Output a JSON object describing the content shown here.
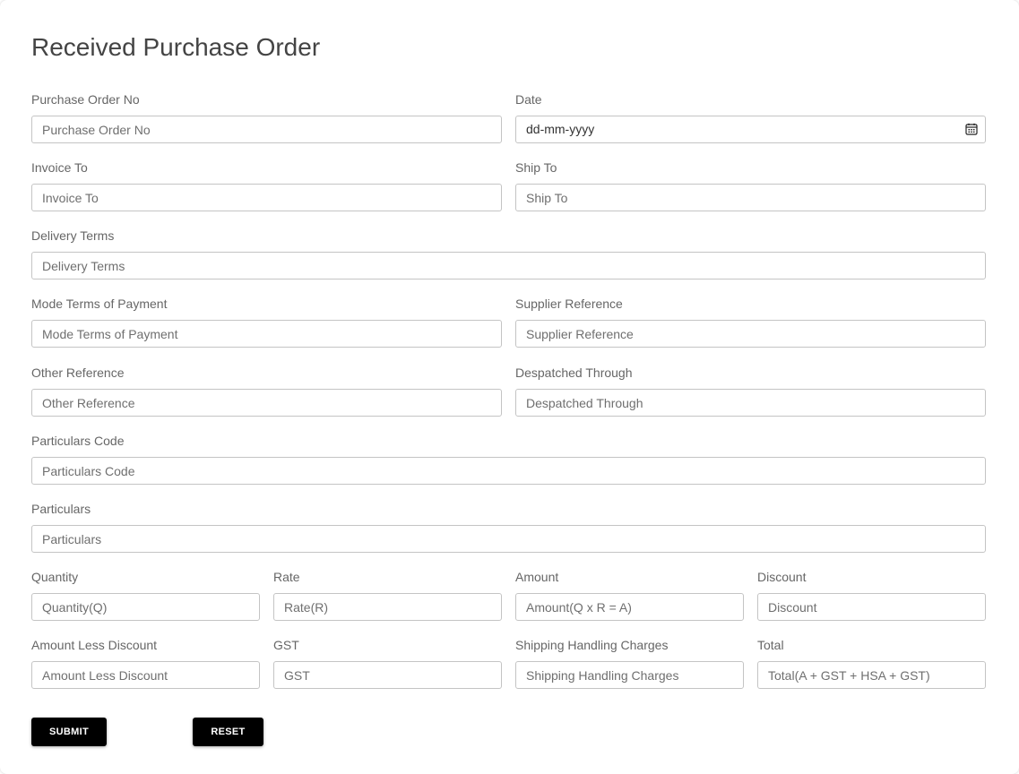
{
  "form": {
    "title": "Received Purchase Order",
    "fields": {
      "purchase_order_no": {
        "label": "Purchase Order No",
        "placeholder": "Purchase Order No"
      },
      "date": {
        "label": "Date",
        "placeholder": "dd-mm-yyyy"
      },
      "invoice_to": {
        "label": "Invoice To",
        "placeholder": "Invoice To"
      },
      "ship_to": {
        "label": "Ship To",
        "placeholder": "Ship To"
      },
      "delivery_terms": {
        "label": "Delivery Terms",
        "placeholder": "Delivery Terms"
      },
      "mode_terms_payment": {
        "label": "Mode Terms of Payment",
        "placeholder": "Mode Terms of Payment"
      },
      "supplier_reference": {
        "label": "Supplier Reference",
        "placeholder": "Supplier Reference"
      },
      "other_reference": {
        "label": "Other Reference",
        "placeholder": "Other Reference"
      },
      "despatched_through": {
        "label": "Despatched Through",
        "placeholder": "Despatched Through"
      },
      "particulars_code": {
        "label": "Particulars Code",
        "placeholder": "Particulars Code"
      },
      "particulars": {
        "label": "Particulars",
        "placeholder": "Particulars"
      },
      "quantity": {
        "label": "Quantity",
        "placeholder": "Quantity(Q)"
      },
      "rate": {
        "label": "Rate",
        "placeholder": "Rate(R)"
      },
      "amount": {
        "label": "Amount",
        "placeholder": "Amount(Q x R = A)"
      },
      "discount": {
        "label": "Discount",
        "placeholder": "Discount"
      },
      "amount_less_discount": {
        "label": "Amount Less Discount",
        "placeholder": "Amount Less Discount"
      },
      "gst": {
        "label": "GST",
        "placeholder": "GST"
      },
      "shipping_handling_charges": {
        "label": "Shipping Handling Charges",
        "placeholder": "Shipping Handling Charges"
      },
      "total": {
        "label": "Total",
        "placeholder": "Total(A + GST + HSA + GST)"
      }
    },
    "buttons": {
      "submit": "SUBMIT",
      "reset": "RESET"
    }
  },
  "icons": {
    "date_picker": "calendar-icon"
  }
}
